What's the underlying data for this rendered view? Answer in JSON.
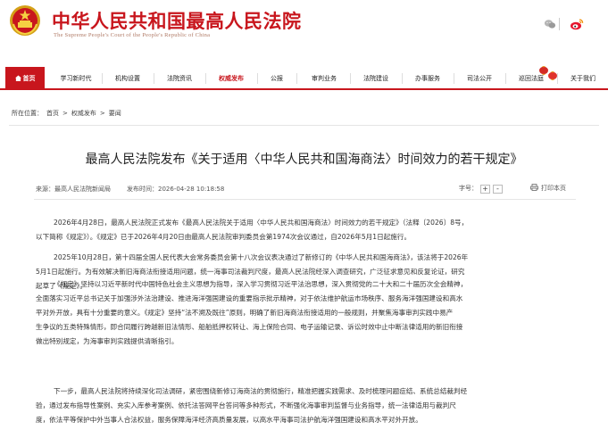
{
  "header": {
    "title": "中华人民共和国最高人民法院",
    "subtitle": "The Supreme People's Court of the People's Republic of China",
    "emblem_icon": "national-emblem-icon",
    "social_icons": [
      "wechat-icon",
      "weibo-icon"
    ]
  },
  "nav": {
    "items": [
      {
        "label": "首页"
      },
      {
        "label": "学习新时代"
      },
      {
        "label": "机构设置"
      },
      {
        "label": "法院资讯"
      },
      {
        "label": "权威发布"
      },
      {
        "label": "公报"
      },
      {
        "label": "审判业务"
      },
      {
        "label": "法院建设"
      },
      {
        "label": "办事服务"
      },
      {
        "label": "司法公开"
      },
      {
        "label": "巡回法庭"
      },
      {
        "label": "关于我们"
      }
    ],
    "current": "权威发布"
  },
  "breadcrumb": {
    "prefix": "所在位置：",
    "items": [
      "首页",
      "权威发布",
      "要闻"
    ],
    "separator": ">"
  },
  "article": {
    "title": "最高人民法院发布《关于适用〈中华人民共和国海商法〉时间效力的若干规定》",
    "source": "来源：最高人民法院新闻局",
    "published": "发布时间：2026-04-28 10:18:58",
    "font_label": "字号：",
    "font_plus": "+",
    "font_minus": "-",
    "print_label": "打印本页",
    "paragraphs": [
      [
        "2026年4月28日，最高人民法院正式发布《最高人民法院关于适用〈中华人民共和国海商法〉时间效力的若干规定》（法释〔2026〕8号，",
        "以下简称《规定》）。《规定》已于2026年4月20日由最高人民法院审判委员会第1974次会议通过，自2026年5月1日起施行。"
      ],
      [
        "2025年10月28日，第十四届全国人民代表大会常务委员会第十八次会议表决通过了新修订的《中华人民共和国海商法》，该法将于2026年",
        "5月1日起施行。为有效解决新旧海商法衔接适用问题，统一海事司法裁判尺度，最高人民法院经深入调查研究，广泛征求意见和反复论证，研究",
        "起草了《规定》。"
      ],
      [
        "《规定》坚持以习近平新时代中国特色社会主义思想为指导，深入学习贯彻习近平法治思想，深入贯彻党的二十大和二十届历次全会精神，",
        "全面落实习近平总书记关于加强涉外法治建设、推进海洋强国建设的重要指示批示精神，对于依法维护航运市场秩序、服务海洋强国建设和高水",
        "平对外开放，具有十分重要的意义。《规定》坚持“法不溯及既往”原则，明确了新旧海商法衔接适用的一般规则，并聚焦海事审判实践中易产",
        "生争议的五类特殊情形，即合同履行跨越新旧法情形、船舶抵押权转让、海上保险合同、电子运输记录、诉讼时效中止中断法律适用的新旧衔接",
        "做出特别规定，为海事审判实践提供清晰指引。"
      ],
      [
        "下一步，最高人民法院将持续深化司法调研，紧密围绕新修订海商法的贯彻施行，精准把握实践需求、及时梳理问题症结、系统总结裁判经",
        "验，通过发布指导性案例、充实入库参考案例、依托法答网平台答问等多种形式，不断强化海事审判监督与业务指导，统一法律适用与裁判尺",
        "度，依法平等保护中外当事人合法权益，服务保障海洋经济高质量发展，以高水平海事司法护航海洋强国建设和高水平对外开放。"
      ]
    ]
  },
  "colors": {
    "brand_red": "#c8161d",
    "text": "#333333",
    "divider": "#e5e5e5"
  }
}
